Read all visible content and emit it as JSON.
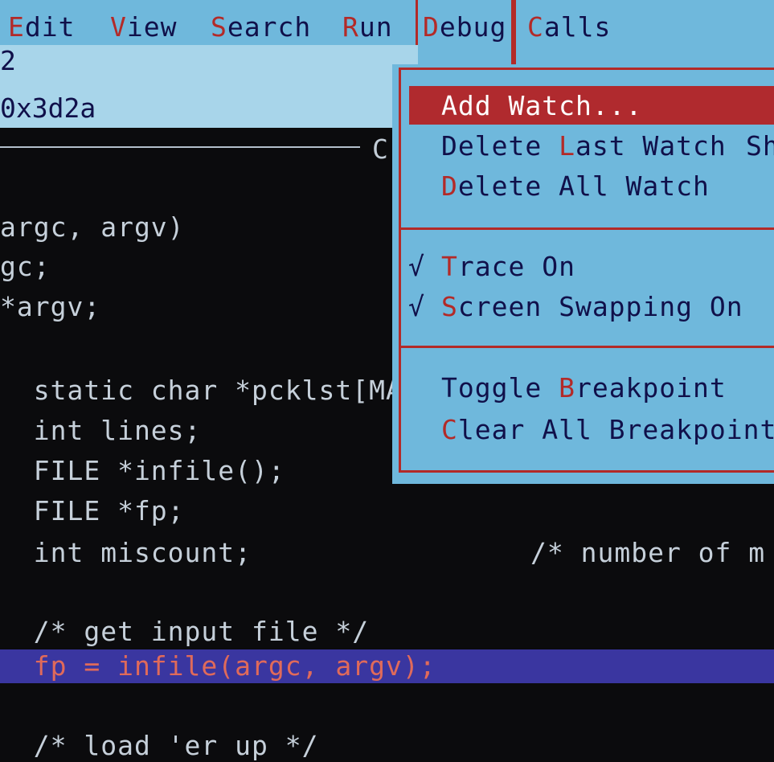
{
  "menubar": {
    "items": [
      {
        "hotkey": "E",
        "rest": "dit"
      },
      {
        "hotkey": "V",
        "rest": "iew"
      },
      {
        "hotkey": "S",
        "rest": "earch"
      },
      {
        "hotkey": "R",
        "rest": "un"
      },
      {
        "hotkey": "D",
        "rest": "ebug"
      },
      {
        "hotkey": "C",
        "rest": "alls"
      }
    ]
  },
  "watch": {
    "lines": [
      "2",
      "0x3d2a"
    ]
  },
  "editor": {
    "window_title": "C",
    "lines": [
      "argc, argv)",
      "gc;",
      "*argv;",
      "  static char *pcklst[MA",
      "  int lines;",
      "  FILE *infile();",
      "  FILE *fp;",
      "  int miscount;",
      "  /* get input file */",
      "  fp = infile(argc, argv);",
      "  /* load 'er up */"
    ],
    "right_comment": "/* number of m"
  },
  "debug_menu": {
    "items": [
      {
        "pre": "",
        "hotkey": "A",
        "post": "dd Watch...",
        "shortcut": ""
      },
      {
        "pre": "Delete ",
        "hotkey": "L",
        "post": "ast Watch",
        "shortcut": "Sh"
      },
      {
        "pre": "",
        "hotkey": "D",
        "post": "elete All Watch",
        "shortcut": ""
      },
      {
        "pre": "",
        "hotkey": "T",
        "post": "race On",
        "shortcut": ""
      },
      {
        "pre": "",
        "hotkey": "S",
        "post": "creen Swapping On",
        "shortcut": ""
      },
      {
        "pre": "Toggle ",
        "hotkey": "B",
        "post": "reakpoint",
        "shortcut": ""
      },
      {
        "pre": "",
        "hotkey": "C",
        "post": "lear All Breakpoints",
        "shortcut": ""
      }
    ],
    "check_mark": "√",
    "colors": {
      "highlight": "#b02a2e",
      "menu_bg": "#6fb8dc",
      "hotkey": "#b32a28"
    }
  },
  "colors": {
    "editor_bg": "#0b0b0d",
    "exec_bar": "#3a36a0",
    "exec_text": "#e06a5a"
  }
}
